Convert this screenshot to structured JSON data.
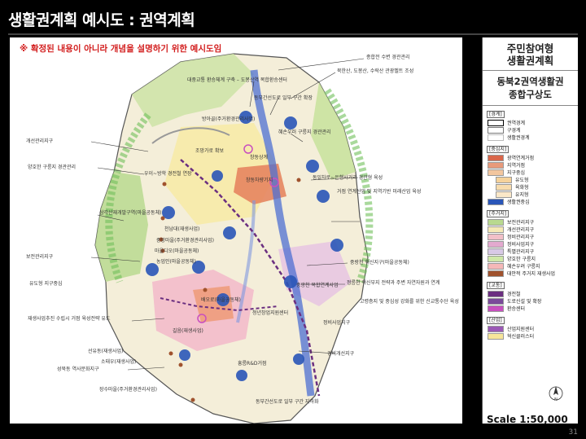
{
  "page": {
    "title": "생활권계획 예시도 : 권역계획",
    "page_number": "31"
  },
  "map": {
    "notice": "※ 확정된 내용이 아니라 개념을 설명하기 위한 예시도임",
    "callouts": [
      "종합전 수변 경관관리",
      "북한산, 도봉산, 수락산 관광벨트 조성",
      "대중교통 환승체계 구축 – 도봉산역 복합환승센터",
      "동부간선도로 일부 구간 확장",
      "방아골(주거환경관리사업)",
      "혜손우러 구릉지 경관관리",
      "개선관리지구",
      "조망가로 확보",
      "창동상계",
      "양호한 구릉지 경관관리",
      "우이~방학 경전철 연장",
      "창동차량기지",
      "동일차로~은행사거리 경관형 육성",
      "거점 연계산업 및 지역기반 미래산업 육성",
      "삼각산재개발구역(마을공동체)",
      "천남대(재생사업)",
      "중앙마을(주거환경관리사업)",
      "보전관리지구",
      "마을디오(마을공동체)",
      "농업인(마을공동체)",
      "중랑천 혁신지구(마을공동체)",
      "유도형 지구중심",
      "중랑천 복합연계사업",
      "정릉천 혁신부지 전략과 주변 자연자원과 연계",
      "배오로(마을공동체)",
      "고령층지 및 중심성 강화를 위한 신교통수단 육성",
      "청년창업지원센터",
      "정비사업지구",
      "재생사업추진 수립시 거점 육성전략 유도",
      "길음(재생사업)",
      "선유동(재생사업)",
      "소태우(재생사업)",
      "흥릉R&D거점",
      "성북동 역사문화지구",
      "장수마을(주거환경관리사업)",
      "동부간선도로 일부 구간 지하화",
      "경비개선지구"
    ]
  },
  "legend": {
    "header_line1": "주민참여형",
    "header_line2": "생활권계획",
    "sub_line1": "동북2권역생활권",
    "sub_line2": "종합구상도",
    "sections": [
      {
        "title": "[경계]",
        "items": [
          {
            "label": "권역경계",
            "color": "#ffffff",
            "border": "#000000"
          },
          {
            "label": "구경계",
            "color": "#ffffff",
            "border": "#777777"
          },
          {
            "label": "생활권경계",
            "color": "#ffffff",
            "border": "#bbbbbb"
          }
        ]
      },
      {
        "title": "[중심지]",
        "items": [
          {
            "label": "광역연계거점",
            "color": "#d9664a"
          },
          {
            "label": "지역거점",
            "color": "#e89a7b"
          },
          {
            "label": "지구중심",
            "color": "#f2c69f"
          },
          {
            "label": "유도형",
            "color": "#f5d29b",
            "indent": true
          },
          {
            "label": "육화형",
            "color": "#f7dcae",
            "indent": true
          },
          {
            "label": "유지형",
            "color": "#fbe8c8",
            "indent": true
          },
          {
            "label": "생활권중심",
            "color": "#2a56b8"
          }
        ]
      },
      {
        "title": "[주거지]",
        "items": [
          {
            "label": "보전관리지구",
            "color": "#b9d98f"
          },
          {
            "label": "개선관리지구",
            "color": "#f5e9b6"
          },
          {
            "label": "정비관리지구",
            "color": "#f2c0c8"
          },
          {
            "label": "정비사업지구",
            "color": "#e3a9cf"
          },
          {
            "label": "특별관리지구",
            "color": "#d8c9e6"
          },
          {
            "label": "양호한 구릉지",
            "color": "#cfe8a8"
          },
          {
            "label": "혜손우려 구릉지",
            "color": "#f5b8b8"
          },
          {
            "label": "대안적 주거지 재생사업",
            "color": "#a0522d"
          }
        ]
      },
      {
        "title": "[교통]",
        "items": [
          {
            "label": "경전철",
            "color": "#6b2f80"
          },
          {
            "label": "도로신설 및 확장",
            "color": "#7a4a9a"
          },
          {
            "label": "환승센터",
            "color": "#c84fbf"
          }
        ]
      },
      {
        "title": "[산업]",
        "items": [
          {
            "label": "산업지원센터",
            "color": "#9b59b6"
          },
          {
            "label": "혁신클러스터",
            "color": "#f7e59a"
          }
        ]
      }
    ],
    "scale": "Scale 1:50,000",
    "compass_label": "N"
  }
}
